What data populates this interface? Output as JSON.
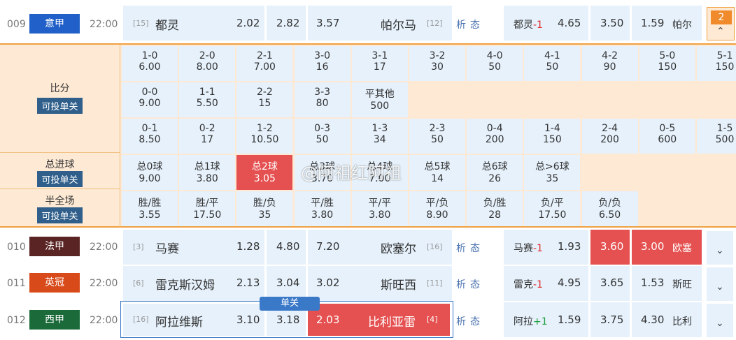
{
  "matches": [
    {
      "num": "009",
      "league": "意甲",
      "league_color": "#2060c8",
      "time": "22:00",
      "home_rank": "[15]",
      "home": "都灵",
      "odd1": "2.02",
      "oddx": "2.82",
      "odd2": "3.57",
      "away": "帕尔马",
      "away_rank": "[12]",
      "analysis": "析态",
      "hcap_team": "都灵",
      "hcap_val": "-1",
      "h1": "4.65",
      "hx": "3.50",
      "h2": "1.59",
      "hcap_away": "帕尔"
    },
    {
      "num": "010",
      "league": "法甲",
      "league_color": "#5a2424",
      "time": "22:00",
      "home_rank": "[3]",
      "home": "马赛",
      "odd1": "1.28",
      "oddx": "4.80",
      "odd2": "7.20",
      "away": "欧塞尔",
      "away_rank": "[16]",
      "analysis": "析态",
      "hcap_team": "马赛",
      "hcap_val": "-1",
      "h1": "1.93",
      "hx": "3.60",
      "h2": "3.00",
      "hcap_away": "欧塞"
    },
    {
      "num": "011",
      "league": "英冠",
      "league_color": "#d84a1a",
      "time": "22:00",
      "home_rank": "[6]",
      "home": "雷克斯汉姆",
      "odd1": "2.13",
      "oddx": "3.04",
      "odd2": "3.02",
      "away": "斯旺西",
      "away_rank": "[11]",
      "analysis": "析态",
      "hcap_team": "雷克",
      "hcap_val": "-1",
      "h1": "4.95",
      "hx": "3.65",
      "h2": "1.53",
      "hcap_away": "斯旺"
    },
    {
      "num": "012",
      "league": "西甲",
      "league_color": "#1a6a3a",
      "time": "22:00",
      "home_rank": "[16]",
      "home": "阿拉维斯",
      "odd1": "3.10",
      "oddx": "3.18",
      "odd2": "2.03",
      "away": "比利亚雷",
      "away_rank": "[4]",
      "analysis": "析态",
      "hcap_team": "阿拉",
      "hcap_val": "+1",
      "h1": "1.59",
      "hx": "3.75",
      "h2": "4.30",
      "hcap_away": "比利"
    }
  ],
  "expand_badge": "2",
  "single_badge": "单关",
  "panel": {
    "score_label": "比分",
    "goals_label": "总进球",
    "halffull_label": "半全场",
    "single_label": "可投单关",
    "score_row1": [
      [
        "1-0",
        "6.00"
      ],
      [
        "2-0",
        "8.00"
      ],
      [
        "2-1",
        "7.00"
      ],
      [
        "3-0",
        "16"
      ],
      [
        "3-1",
        "17"
      ],
      [
        "3-2",
        "30"
      ],
      [
        "4-0",
        "50"
      ],
      [
        "4-1",
        "50"
      ],
      [
        "4-2",
        "90"
      ],
      [
        "5-0",
        "150"
      ],
      [
        "5-1",
        "150"
      ]
    ],
    "score_row2": [
      [
        "0-0",
        "9.00"
      ],
      [
        "1-1",
        "5.50"
      ],
      [
        "2-2",
        "15"
      ],
      [
        "3-3",
        "80"
      ],
      [
        "平其他",
        "500"
      ]
    ],
    "score_row3": [
      [
        "0-1",
        "8.50"
      ],
      [
        "0-2",
        "17"
      ],
      [
        "1-2",
        "10.50"
      ],
      [
        "0-3",
        "50"
      ],
      [
        "1-3",
        "34"
      ],
      [
        "2-3",
        "50"
      ],
      [
        "0-4",
        "200"
      ],
      [
        "1-4",
        "150"
      ],
      [
        "2-4",
        "200"
      ],
      [
        "0-5",
        "600"
      ],
      [
        "1-5",
        "500"
      ]
    ],
    "goals": [
      [
        "总0球",
        "9.00"
      ],
      [
        "总1球",
        "3.80"
      ],
      [
        "总2球",
        "3.05"
      ],
      [
        "总3球",
        "3.70"
      ],
      [
        "总4球",
        "7.00"
      ],
      [
        "总5球",
        "14"
      ],
      [
        "总6球",
        "26"
      ],
      [
        "总>6球",
        "35"
      ]
    ],
    "halffull": [
      [
        "胜/胜",
        "3.55"
      ],
      [
        "胜/平",
        "17.50"
      ],
      [
        "胜/负",
        "35"
      ],
      [
        "平/胜",
        "3.80"
      ],
      [
        "平/平",
        "3.80"
      ],
      [
        "平/负",
        "8.90"
      ],
      [
        "负/胜",
        "28"
      ],
      [
        "负/平",
        "17.50"
      ],
      [
        "负/负",
        "6.50"
      ]
    ]
  },
  "watermark": "@阿祖红阿祖",
  "colors": {
    "cell_bg": "#e6f1fb",
    "selected": "#e55050",
    "panel_bg": "#fde9d4",
    "panel_border": "#f0a040"
  }
}
